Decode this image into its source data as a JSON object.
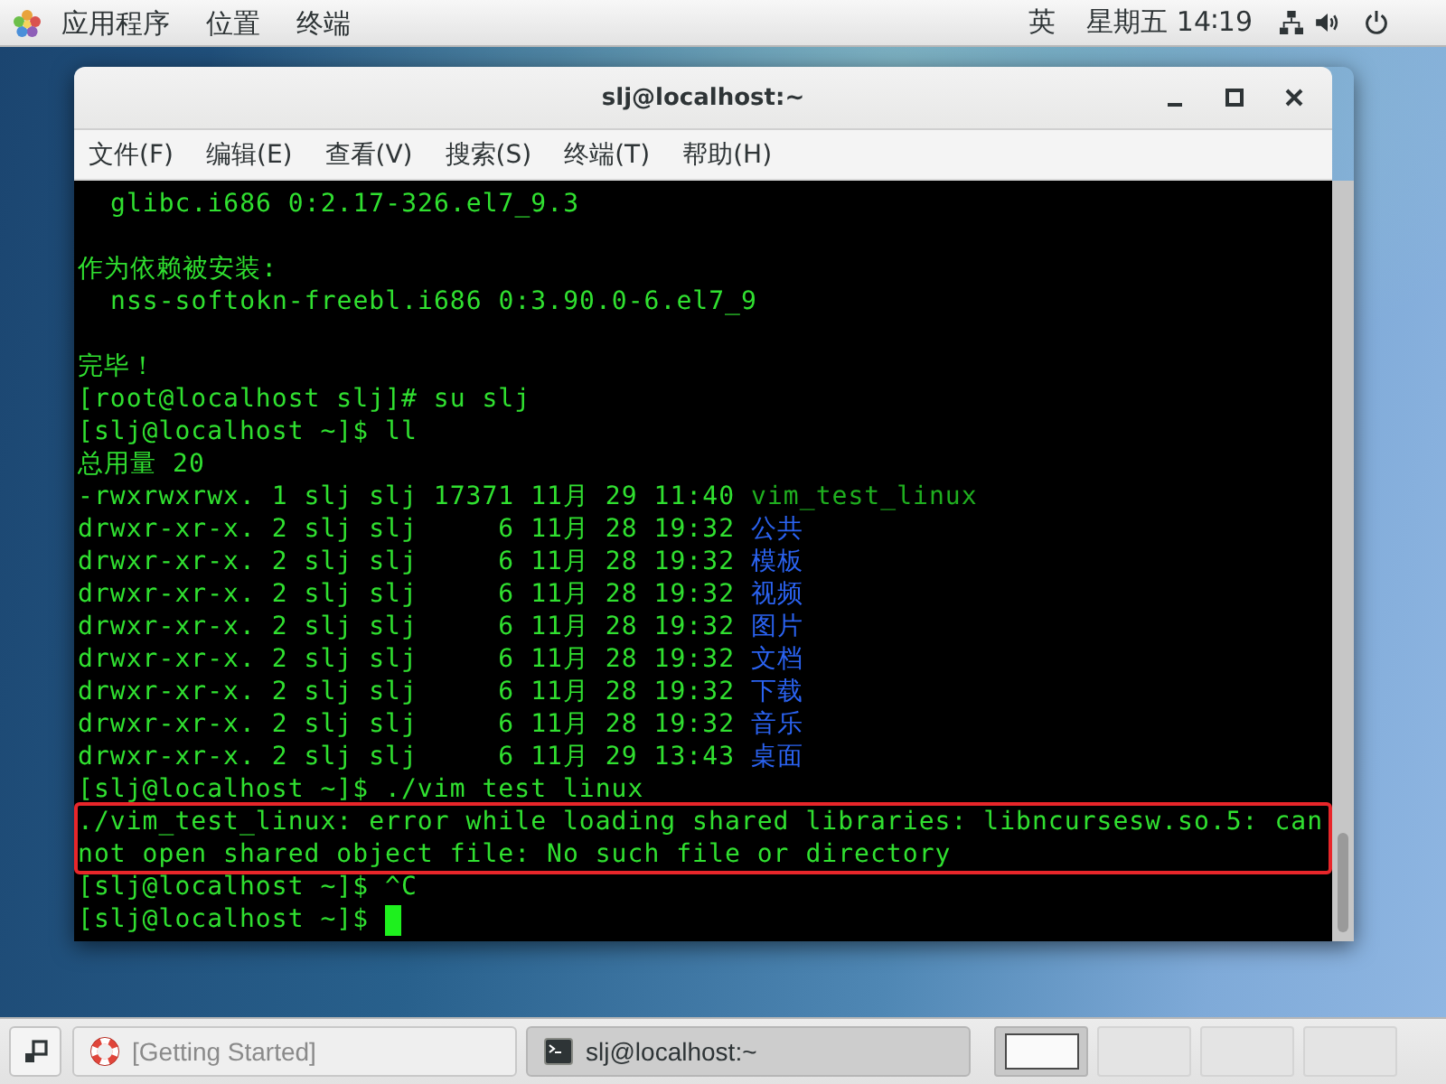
{
  "top_bar": {
    "menus": [
      {
        "label": "应用程序"
      },
      {
        "label": "位置"
      },
      {
        "label": "终端"
      }
    ],
    "input_method": "英",
    "clock": "星期五 14∶19"
  },
  "window": {
    "title": "slj@localhost:~",
    "menu": [
      "文件(F)",
      "编辑(E)",
      "查看(V)",
      "搜索(S)",
      "终端(T)",
      "帮助(H)"
    ],
    "terminal": {
      "lines": [
        {
          "kind": "detail",
          "text": "glibc.i686 0:2.17-326.el7_9.3"
        },
        {
          "kind": "blank"
        },
        {
          "kind": "output",
          "text": "作为依赖被安装:"
        },
        {
          "kind": "detail",
          "text": "nss-softokn-freebl.i686 0:3.90.0-6.el7_9"
        },
        {
          "kind": "blank"
        },
        {
          "kind": "output",
          "text": "完毕！"
        },
        {
          "kind": "output",
          "text": "[root@localhost slj]# su slj"
        },
        {
          "kind": "output",
          "text": "[slj@localhost ~]$ ll"
        },
        {
          "kind": "output",
          "text": "总用量 20"
        },
        {
          "kind": "listing",
          "text": "-rwxrwxrwx. 1 slj slj 17371 11月 29 11:40",
          "file": "vim_test_linux",
          "color": "#1fae1f"
        },
        {
          "kind": "listing",
          "text": "drwxr-xr-x. 2 slj slj     6 11月 28 19:32",
          "file": "公共",
          "color": "#2a62f0"
        },
        {
          "kind": "listing",
          "text": "drwxr-xr-x. 2 slj slj     6 11月 28 19:32",
          "file": "模板",
          "color": "#2a62f0"
        },
        {
          "kind": "listing",
          "text": "drwxr-xr-x. 2 slj slj     6 11月 28 19:32",
          "file": "视频",
          "color": "#2a62f0"
        },
        {
          "kind": "listing",
          "text": "drwxr-xr-x. 2 slj slj     6 11月 28 19:32",
          "file": "图片",
          "color": "#2a62f0"
        },
        {
          "kind": "listing",
          "text": "drwxr-xr-x. 2 slj slj     6 11月 28 19:32",
          "file": "文档",
          "color": "#2a62f0"
        },
        {
          "kind": "listing",
          "text": "drwxr-xr-x. 2 slj slj     6 11月 28 19:32",
          "file": "下载",
          "color": "#2a62f0"
        },
        {
          "kind": "listing",
          "text": "drwxr-xr-x. 2 slj slj     6 11月 28 19:32",
          "file": "音乐",
          "color": "#2a62f0"
        },
        {
          "kind": "listing",
          "text": "drwxr-xr-x. 2 slj slj     6 11月 29 13:43",
          "file": "桌面",
          "color": "#2a62f0"
        },
        {
          "kind": "output",
          "text": "[slj@localhost ~]$ ./vim test linux"
        },
        {
          "kind": "highlight",
          "lines": [
            "./vim_test_linux: error while loading shared libraries: libncursesw.so.5: can",
            "not open shared object file: No such file or directory"
          ]
        },
        {
          "kind": "output",
          "text": "[slj@localhost ~]$ ^C"
        },
        {
          "kind": "prompt",
          "text": "[slj@localhost ~]$",
          "cursor": true
        }
      ]
    }
  },
  "taskbar": {
    "tasks": [
      {
        "label": "[Getting Started]",
        "kind": "help",
        "selected": false,
        "minimized": true
      },
      {
        "label": "slj@localhost:~",
        "kind": "terminal",
        "selected": true,
        "minimized": false
      }
    ],
    "workspaces": [
      {
        "selected": true,
        "has_window": true
      },
      {
        "selected": false,
        "has_window": false
      },
      {
        "selected": false,
        "has_window": false
      },
      {
        "selected": false,
        "has_window": false
      }
    ]
  }
}
